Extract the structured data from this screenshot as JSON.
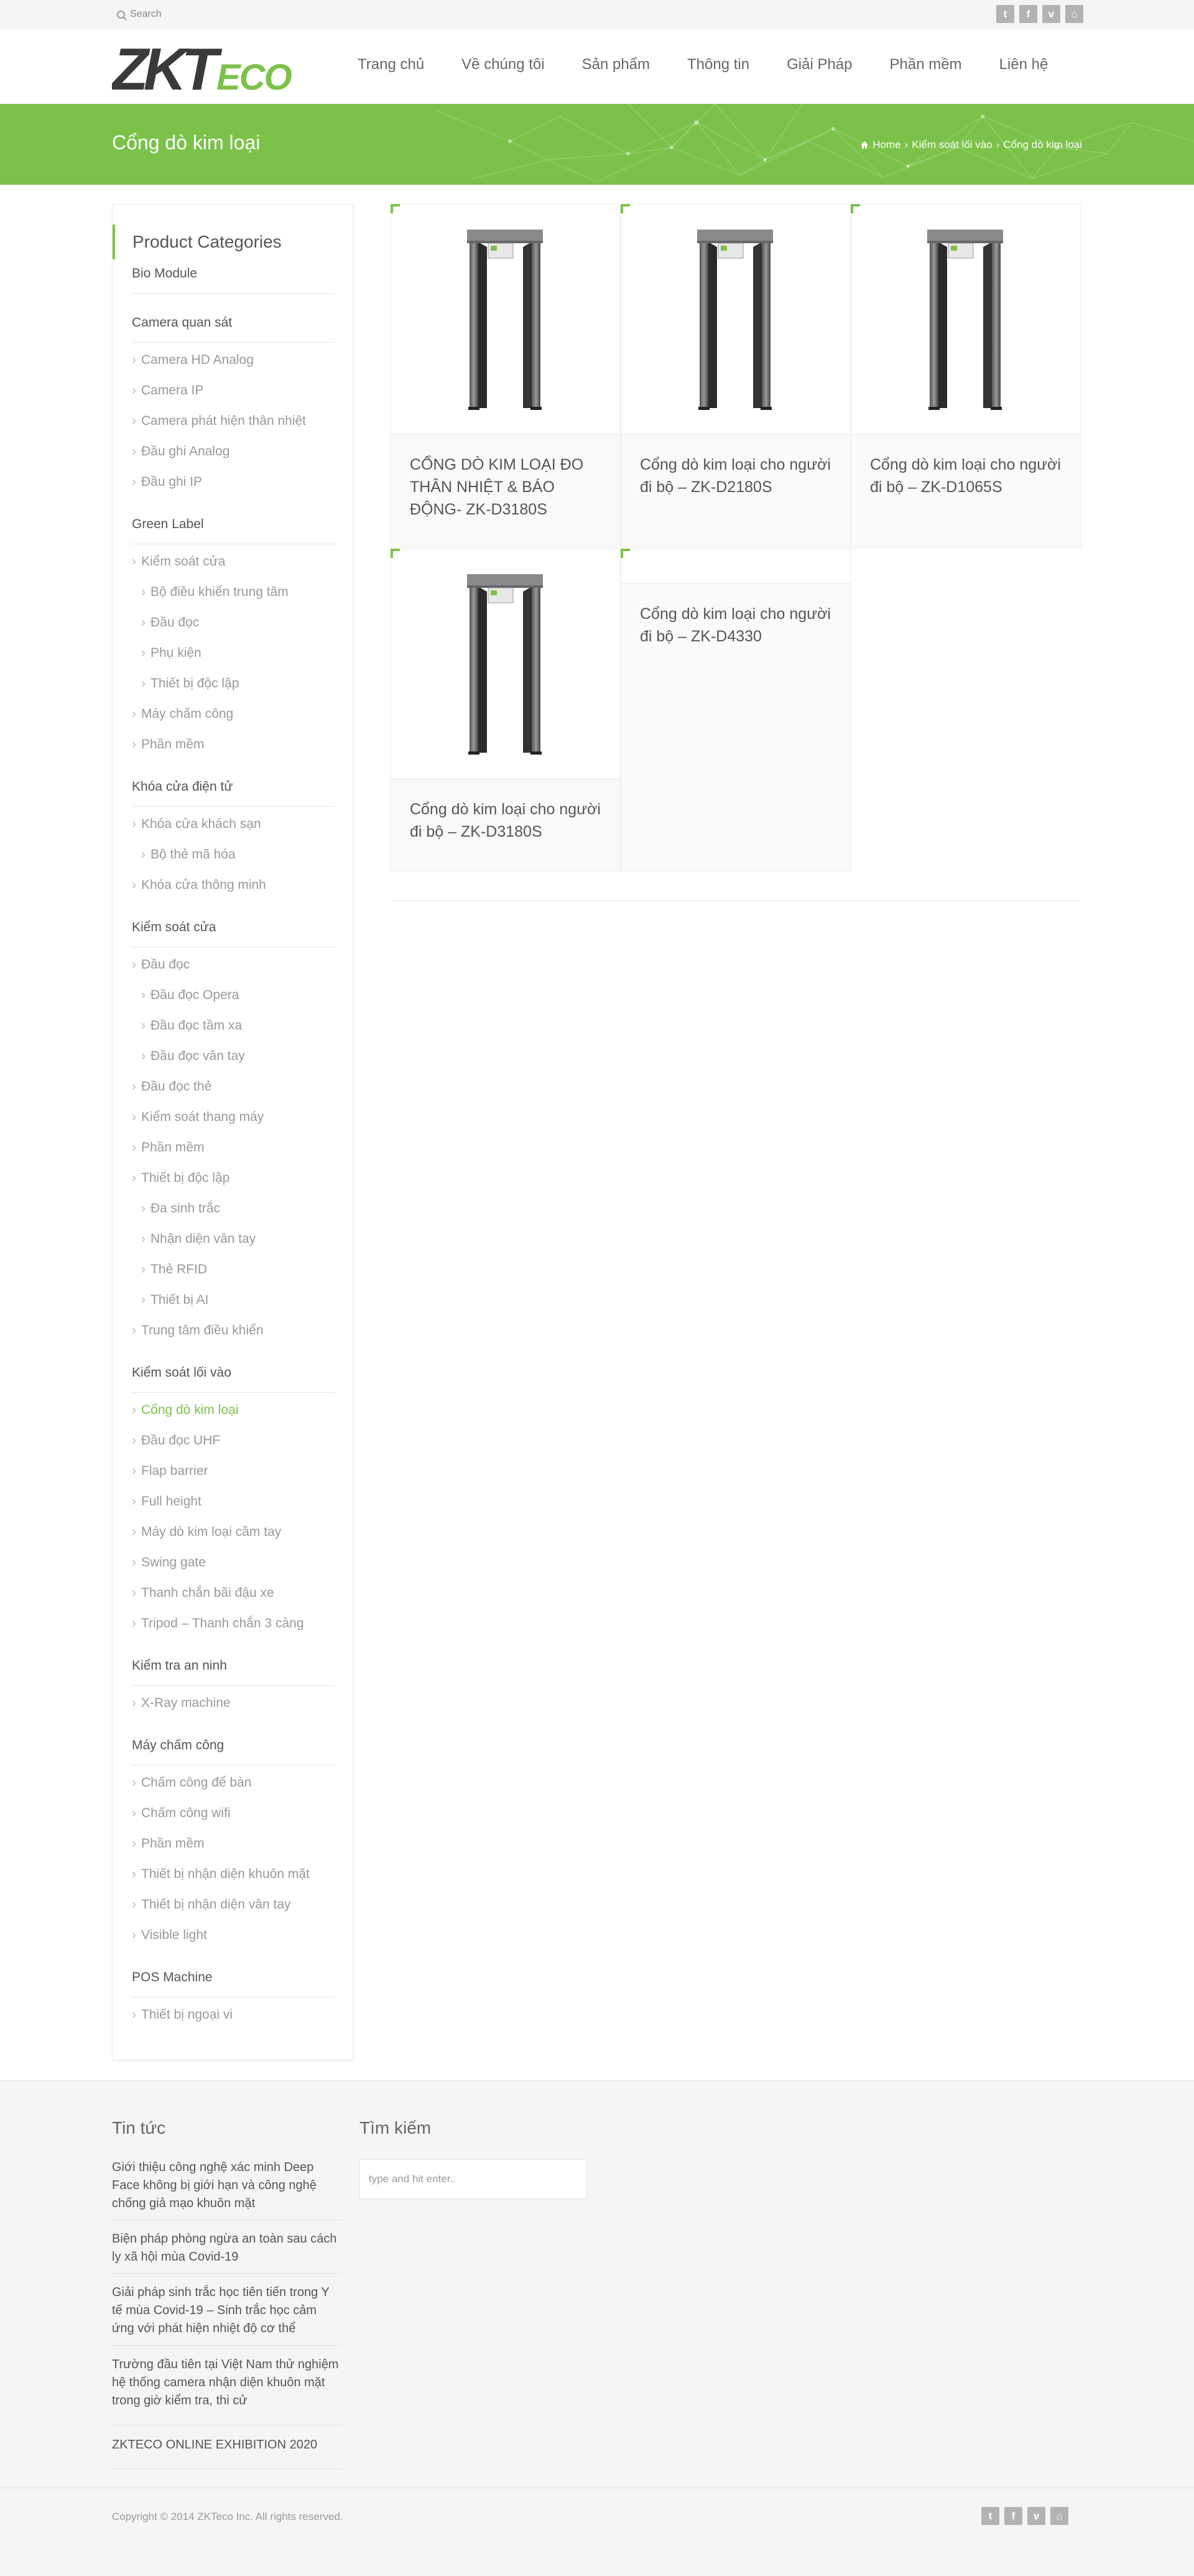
{
  "topbar": {
    "search_label": "Search",
    "social": [
      {
        "name": "twitter-icon",
        "glyph": "t"
      },
      {
        "name": "facebook-icon",
        "glyph": "f"
      },
      {
        "name": "vimeo-icon",
        "glyph": "v"
      },
      {
        "name": "vine-icon",
        "glyph": "⌂"
      }
    ]
  },
  "header": {
    "logo_text_1": "ZKT",
    "logo_text_2": "ECO",
    "nav": [
      "Trang chủ",
      "Về chúng tôi",
      "Sản phẩm",
      "Thông tin",
      "Giải Pháp",
      "Phần mềm",
      "Liên hệ"
    ]
  },
  "banner": {
    "title": "Cổng dò kim loại",
    "breadcrumb": [
      "Home",
      "Kiểm soát lối vào",
      "Cổng dò kim loại"
    ],
    "separator": "›"
  },
  "sidebar": {
    "heading": "Product Categories",
    "items": [
      {
        "label": "Bio Module",
        "level": 0
      },
      {
        "label": "Camera quan sát",
        "level": 0
      },
      {
        "label": "Camera HD Analog",
        "level": 1
      },
      {
        "label": "Camera IP",
        "level": 1
      },
      {
        "label": "Camera phát hiện thân nhiệt",
        "level": 1
      },
      {
        "label": "Đầu ghi Analog",
        "level": 1
      },
      {
        "label": "Đầu ghi IP",
        "level": 1
      },
      {
        "label": "Green Label",
        "level": 0
      },
      {
        "label": "Kiểm soát cửa",
        "level": 1
      },
      {
        "label": "Bộ điều khiển trung tâm",
        "level": 2
      },
      {
        "label": "Đầu đọc",
        "level": 2
      },
      {
        "label": "Phụ kiện",
        "level": 2
      },
      {
        "label": "Thiết bị độc lập",
        "level": 2
      },
      {
        "label": "Máy chấm công",
        "level": 1
      },
      {
        "label": "Phần mềm",
        "level": 1
      },
      {
        "label": "Khóa cửa điện tử",
        "level": 0
      },
      {
        "label": "Khóa cửa khách sạn",
        "level": 1
      },
      {
        "label": "Bộ thẻ mã hóa",
        "level": 2
      },
      {
        "label": "Khóa cửa thông minh",
        "level": 1
      },
      {
        "label": "Kiểm soát cửa",
        "level": 0
      },
      {
        "label": "Đầu đọc",
        "level": 1
      },
      {
        "label": "Đầu đọc Opera",
        "level": 2
      },
      {
        "label": "Đầu đọc tầm xa",
        "level": 2
      },
      {
        "label": "Đầu đọc vân tay",
        "level": 2
      },
      {
        "label": "Đầu đọc thẻ",
        "level": 1
      },
      {
        "label": "Kiểm soát thang máy",
        "level": 1
      },
      {
        "label": "Phần mềm",
        "level": 1
      },
      {
        "label": "Thiết bị độc lập",
        "level": 1
      },
      {
        "label": "Đa sinh trắc",
        "level": 2
      },
      {
        "label": "Nhận diện vân tay",
        "level": 2
      },
      {
        "label": "Thẻ RFID",
        "level": 2
      },
      {
        "label": "Thiết bị AI",
        "level": 2
      },
      {
        "label": "Trung tâm điều khiển",
        "level": 1
      },
      {
        "label": "Kiểm soát lối vào",
        "level": 0
      },
      {
        "label": "Cổng dò kim loại",
        "level": 1,
        "active": true
      },
      {
        "label": "Đầu đọc UHF",
        "level": 1
      },
      {
        "label": "Flap barrier",
        "level": 1
      },
      {
        "label": "Full height",
        "level": 1
      },
      {
        "label": "Máy dò kim loại cầm tay",
        "level": 1
      },
      {
        "label": "Swing gate",
        "level": 1
      },
      {
        "label": "Thanh chắn bãi đậu xe",
        "level": 1
      },
      {
        "label": "Tripod – Thanh chắn 3 càng",
        "level": 1
      },
      {
        "label": "Kiểm tra an ninh",
        "level": 0
      },
      {
        "label": "X-Ray machine",
        "level": 1
      },
      {
        "label": "Máy chấm công",
        "level": 0
      },
      {
        "label": "Chấm công để bàn",
        "level": 1
      },
      {
        "label": "Chấm công wifi",
        "level": 1
      },
      {
        "label": "Phần mềm",
        "level": 1
      },
      {
        "label": "Thiết bị nhận diện khuôn mặt",
        "level": 1
      },
      {
        "label": "Thiết bị nhận diện vân tay",
        "level": 1
      },
      {
        "label": "Visible light",
        "level": 1
      },
      {
        "label": "POS Machine",
        "level": 0
      },
      {
        "label": "Thiết bị ngoại vi",
        "level": 1
      }
    ]
  },
  "products": [
    {
      "name": "CỔNG DÒ KIM LOẠI ĐO THÂN NHIỆT & BÁO ĐỘNG- ZK-D3180S",
      "has_image": true,
      "screen": true
    },
    {
      "name": "Cổng dò kim loại cho người đi bộ – ZK-D2180S",
      "has_image": true,
      "screen": true
    },
    {
      "name": "Cổng dò kim loại cho người đi bộ – ZK-D1065S",
      "has_image": true,
      "screen": true
    },
    {
      "name": "Cổng dò kim loại cho người đi bộ – ZK-D3180S",
      "has_image": true,
      "screen": true
    },
    {
      "name": "Cổng dò kim loại cho người đi bộ – ZK-D4330",
      "has_image": false,
      "screen": false
    }
  ],
  "footer": {
    "news_heading": "Tin tức",
    "news": [
      "Giới thiệu công nghệ xác minh Deep Face không bị giới hạn và công nghệ chống giả mạo khuôn mặt",
      "Biện pháp phòng ngừa an toàn sau cách ly xã hội mùa Covid-19",
      "Giải pháp sinh trắc học tiên tiến trong Y tế mùa Covid-19 – Sinh trắc học cảm ứng với phát hiện nhiệt độ cơ thể",
      "Trường đầu tiên tại Việt Nam thử nghiệm hệ thống camera nhận diện khuôn mặt trong giờ kiểm tra, thi cử",
      "ZKTECO ONLINE EXHIBITION 2020"
    ],
    "search_heading": "Tìm kiếm",
    "search_placeholder": "type and hit enter..",
    "copyright": "Copyright © 2014 ZKTeco Inc. All rights reserved."
  },
  "colors": {
    "accent": "#7cc24a",
    "logo_dark": "#3a3a3a",
    "icon_grey": "#b3b3b3"
  }
}
